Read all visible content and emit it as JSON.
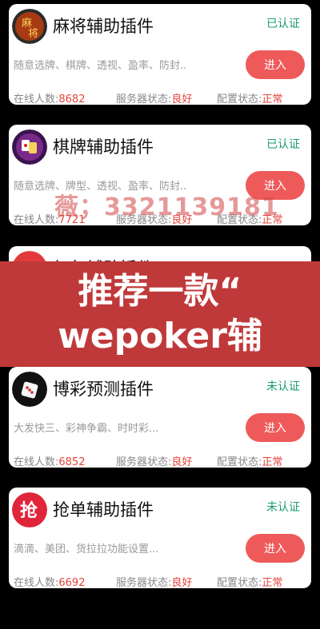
{
  "banner": {
    "line1": "推荐一款“",
    "line2": "wepoker辅"
  },
  "watermark": "薇；3321139181",
  "cards": [
    {
      "logo_icon": "mahjong-logo-icon",
      "title": "麻将辅助插件",
      "badge": "已认证",
      "desc": "随意选牌、棋牌、透视、盈率、防封..",
      "button": "进入",
      "online_label": "在线人数:",
      "online_value": "8682",
      "server_label": "服务器状态:",
      "server_value": "良好",
      "config_label": "配置状态:",
      "config_value": "正常"
    },
    {
      "logo_icon": "chess-card-logo-icon",
      "title": "棋牌辅助插件",
      "badge": "已认证",
      "desc": "随意选牌、牌型、透视、盈率、防封..",
      "button": "进入",
      "online_label": "在线人数:",
      "online_value": "7721",
      "server_label": "服务器状态:",
      "server_value": "良好",
      "config_label": "配置状态:",
      "config_value": "正常"
    },
    {
      "logo_icon": "red-logo-icon",
      "title": "红包辅助插件"
    },
    {
      "logo_icon": "lottery-logo-icon",
      "title": "博彩预测插件",
      "badge": "未认证",
      "desc": "大发快三、彩神争霸、时时彩...",
      "button": "进入",
      "online_label": "在线人数:",
      "online_value": "6852",
      "server_label": "服务器状态:",
      "server_value": "良好",
      "config_label": "配置状态:",
      "config_value": "正常"
    },
    {
      "logo_icon": "grab-order-logo-icon",
      "title": "抢单辅助插件",
      "badge": "未认证",
      "desc": "滴滴、美团、货拉拉功能设置...",
      "button": "进入",
      "online_label": "在线人数:",
      "online_value": "6692",
      "server_label": "服务器状态:",
      "server_value": "良好",
      "config_label": "配置状态:",
      "config_value": "正常"
    }
  ],
  "colors": {
    "accent": "#ee5a5a",
    "verified": "#1a9b6a",
    "banner": "#c0393a"
  }
}
